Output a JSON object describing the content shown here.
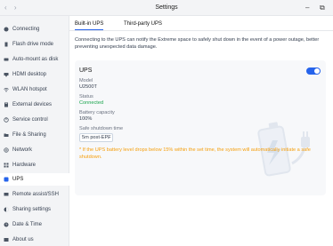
{
  "window": {
    "title": "Settings",
    "back_icon": "‹",
    "forward_icon": "›",
    "minimize_icon": "–",
    "restore_icon": "⧉"
  },
  "sidebar": {
    "items": [
      {
        "label": "Connecting",
        "icon": "connecting-icon"
      },
      {
        "label": "Flash drive mode",
        "icon": "flash-drive-icon"
      },
      {
        "label": "Auto-mount as disk",
        "icon": "disk-icon"
      },
      {
        "label": "HDMI desktop",
        "icon": "hdmi-icon"
      },
      {
        "label": "WLAN hotspot",
        "icon": "wifi-icon"
      },
      {
        "label": "External devices",
        "icon": "external-devices-icon"
      },
      {
        "label": "Service control",
        "icon": "service-control-icon"
      },
      {
        "label": "File & Sharing",
        "icon": "folder-icon"
      },
      {
        "label": "Network",
        "icon": "network-icon"
      },
      {
        "label": "Hardware",
        "icon": "hardware-icon"
      },
      {
        "label": "UPS",
        "icon": "ups-icon",
        "active": true
      },
      {
        "label": "Remote assist/SSH",
        "icon": "remote-icon"
      },
      {
        "label": "Sharing settings",
        "icon": "sharing-icon"
      },
      {
        "label": "Date & Time",
        "icon": "clock-icon"
      },
      {
        "label": "About  us",
        "icon": "info-icon"
      }
    ]
  },
  "main": {
    "tabs": [
      {
        "label": "Built-in UPS",
        "active": true
      },
      {
        "label": "Third-party UPS",
        "active": false
      }
    ],
    "description": "Connecting to the UPS can notify the Extreme space to safely shut down in the event of a power outage, better preventing unexpected data damage.",
    "ups_card": {
      "title": "UPS",
      "enabled": true,
      "model_label": "Model",
      "model_value": "U2500T",
      "status_label": "Status",
      "status_value": "Connected",
      "capacity_label": "Battery capacity",
      "capacity_value": "100%",
      "shutdown_label": "Safe shutdown time",
      "shutdown_value": "5m post-EPF",
      "note": "* If the UPS battery level drops below 15% within the set time, the system will automatically initiate a safe shutdown."
    }
  },
  "colors": {
    "accent": "#2563eb",
    "status_connected": "#16a34a",
    "warning": "#f59e0b",
    "sidebar_bg": "#f3f4f6"
  }
}
